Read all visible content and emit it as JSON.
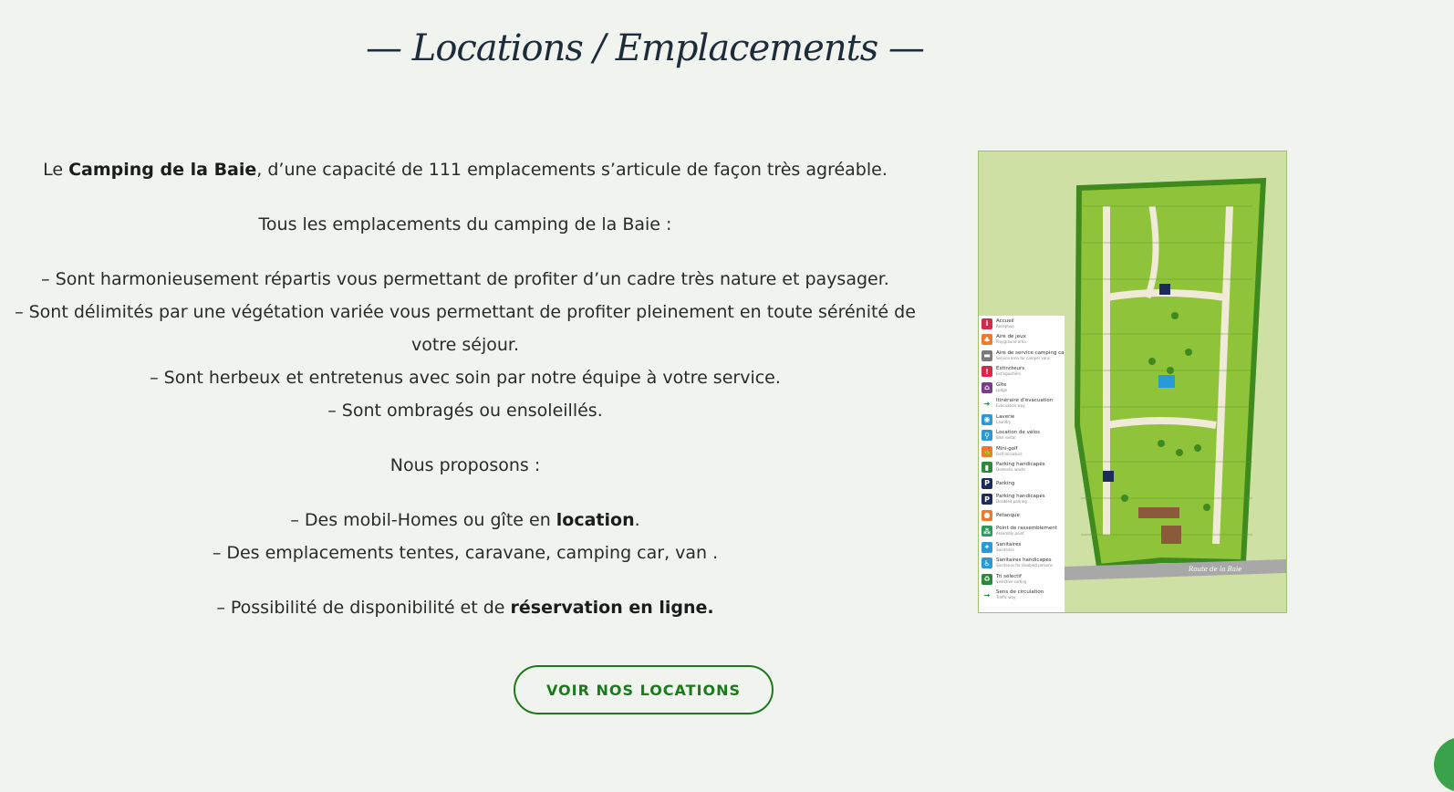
{
  "page": {
    "title": "— Locations / Emplacements —",
    "intro": {
      "pre": "Le ",
      "bold": "Camping de la Baie",
      "post": ", d’une capacité de 111 emplacements s’articule de façon très agréable."
    },
    "subtitle": "Tous les emplacements du camping de la Baie :",
    "features": [
      "– Sont harmonieusement répartis vous permettant de profiter d’un cadre très nature et paysager.",
      "– Sont délimités par une végétation variée vous permettant de profiter pleinement en toute sérénité de votre séjour.",
      "– Sont herbeux et entretenus avec soin par notre équipe à votre service.",
      "– Sont ombragés ou ensoleillés."
    ],
    "propose_title": "Nous proposons :",
    "offer1": {
      "pre": "– Des mobil-Homes ou gîte en ",
      "bold": "location",
      "post": "."
    },
    "offer2": "– Des emplacements tentes, caravane, camping car, van .",
    "booking": {
      "pre": "– Possibilité de disponibilité et de ",
      "bold": "réservation en ligne."
    },
    "cta_label": "VOIR NOS LOCATIONS"
  },
  "map": {
    "road_label": "Route de la Baie",
    "legend": [
      {
        "label": "Accueil",
        "sub": "Reception",
        "icon": "info-icon",
        "color": "#d6294a",
        "glyph": "i"
      },
      {
        "label": "Aire de jeux",
        "sub": "Playground area",
        "icon": "playground-icon",
        "color": "#ee7a2a",
        "glyph": "♣"
      },
      {
        "label": "Aire de service camping car",
        "sub": "Service area for camper vans",
        "icon": "camper-icon",
        "color": "#7a7a7a",
        "glyph": "▬"
      },
      {
        "label": "Extincteurs",
        "sub": "Extinguishers",
        "icon": "extinguisher-icon",
        "color": "#d6294a",
        "glyph": "!"
      },
      {
        "label": "Gîte",
        "sub": "Lodge",
        "icon": "house-icon",
        "color": "#7c3a8c",
        "glyph": "⌂"
      },
      {
        "label": "Itinéraire d’évacuation",
        "sub": "Evacuation way",
        "icon": "arrow-icon",
        "color": "#ffffff",
        "glyph": "➜"
      },
      {
        "label": "Laverie",
        "sub": "Laundry",
        "icon": "laundry-icon",
        "color": "#2a9ad6",
        "glyph": "◉"
      },
      {
        "label": "Location de vélos",
        "sub": "Bike rental",
        "icon": "bike-icon",
        "color": "#2a9ad6",
        "glyph": "⚲"
      },
      {
        "label": "Mini-golf",
        "sub": "Golf miniature",
        "icon": "golf-icon",
        "color": "#ee7a2a",
        "glyph": "⛳"
      },
      {
        "label": "Parking handicapés",
        "sub": "Domestic waste",
        "icon": "bin-icon",
        "color": "#2a8a3a",
        "glyph": "▮"
      },
      {
        "label": "Parking",
        "sub": "",
        "icon": "parking-icon",
        "color": "#1d2b5a",
        "glyph": "P"
      },
      {
        "label": "Parking handicapés",
        "sub": "Disabled parking",
        "icon": "disabled-parking-icon",
        "color": "#1d2b5a",
        "glyph": "P"
      },
      {
        "label": "Pétanque",
        "sub": "",
        "icon": "petanque-icon",
        "color": "#ee7a2a",
        "glyph": "●"
      },
      {
        "label": "Point de rassemblement",
        "sub": "Assembly point",
        "icon": "assembly-icon",
        "color": "#2a9a5a",
        "glyph": "⁂"
      },
      {
        "label": "Sanitaires",
        "sub": "Sanitaries",
        "icon": "wc-icon",
        "color": "#2a9ad6",
        "glyph": "✦"
      },
      {
        "label": "Sanitaires handicapés",
        "sub": "Sanitaries for disabled persons",
        "icon": "wc-disabled-icon",
        "color": "#2a9ad6",
        "glyph": "♿"
      },
      {
        "label": "Tri sélectif",
        "sub": "Selective sorting",
        "icon": "recycle-icon",
        "color": "#2a8a3a",
        "glyph": "♻"
      },
      {
        "label": "Sens de circulation",
        "sub": "Traffic way",
        "icon": "direction-icon",
        "color": "#ffffff",
        "glyph": "→"
      }
    ]
  }
}
